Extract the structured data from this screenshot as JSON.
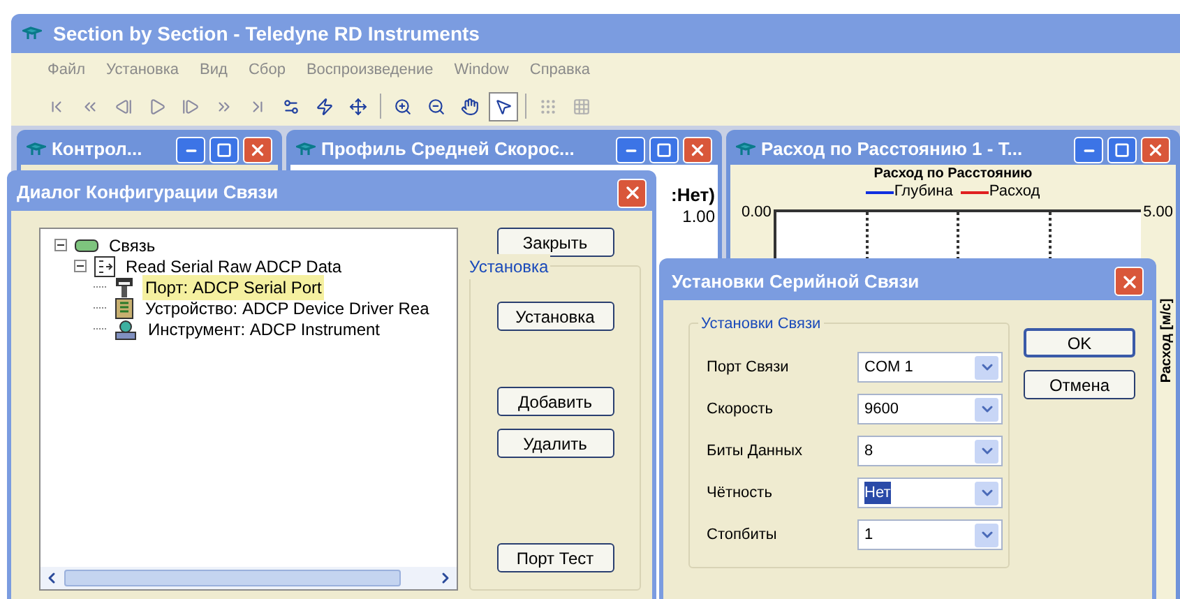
{
  "app": {
    "title": "Section by Section - Teledyne RD Instruments"
  },
  "menu": [
    "Файл",
    "Установка",
    "Вид",
    "Сбор",
    "Воспроизведение",
    "Window",
    "Справка"
  ],
  "toolbar": [
    {
      "kind": "first",
      "selected": false
    },
    {
      "kind": "fast-back",
      "selected": false
    },
    {
      "kind": "prev",
      "selected": false
    },
    {
      "kind": "play",
      "selected": false
    },
    {
      "kind": "next",
      "selected": false
    },
    {
      "kind": "pause-next",
      "selected": false
    },
    {
      "kind": "last",
      "selected": false
    },
    {
      "kind": "properties",
      "selected": false
    },
    {
      "kind": "lightning",
      "selected": false
    },
    {
      "kind": "fit",
      "selected": false
    },
    {
      "kind": "zoom-in",
      "selected": false
    },
    {
      "kind": "zoom-out",
      "selected": false
    },
    {
      "kind": "hand",
      "selected": false
    },
    {
      "kind": "pointer",
      "selected": true
    },
    {
      "kind": "grid-a",
      "selected": false
    },
    {
      "kind": "grid-b",
      "selected": false
    }
  ],
  "child_windows": [
    {
      "title": "Контрол..."
    },
    {
      "title": "Профиль Средней Скорос...",
      "texts": [
        ":Нет)",
        "1.00"
      ]
    },
    {
      "title": "Расход по Расстоянию 1 - Т...",
      "plot": {
        "title": "Расход по Расстоянию",
        "legend": [
          {
            "label": "Глубина",
            "color": "#1030e0"
          },
          {
            "label": "Расход",
            "color": "#e02020"
          }
        ],
        "left_axis": "0.00",
        "right_axis": "5.00",
        "ylabel": "Расход [м/с]"
      }
    }
  ],
  "config_dialog": {
    "title": "Диалог Конфигурации Связи",
    "tree": [
      {
        "label": "Связь",
        "kind": "link",
        "expanded": true,
        "selected": false,
        "children": [
          {
            "label": "Read Serial Raw ADCP Data",
            "kind": "module",
            "expanded": true,
            "selected": false,
            "children": [
              {
                "label": "Порт: ADCP Serial Port",
                "kind": "port",
                "selected": true
              },
              {
                "label": "Устройство: ADCP Device Driver Rea",
                "kind": "device",
                "selected": false
              },
              {
                "label": "Инструмент: ADCP Instrument",
                "kind": "instrument",
                "selected": false
              }
            ]
          }
        ]
      }
    ],
    "close_button": "Закрыть",
    "group": {
      "label": "Установка",
      "buttons": [
        "Установка",
        "Добавить",
        "Удалить"
      ]
    },
    "port_test_button": "Порт Тест"
  },
  "serial_dialog": {
    "title": "Установки Серийной Связи",
    "group_label": "Установки Связи",
    "fields": [
      {
        "label": "Порт Связи",
        "value": "COM 1",
        "text_selected": false
      },
      {
        "label": "Скорость",
        "value": "9600",
        "text_selected": false
      },
      {
        "label": "Биты Данных",
        "value": "8",
        "text_selected": false
      },
      {
        "label": "Чётность",
        "value": "Нет",
        "text_selected": true
      },
      {
        "label": "Стопбиты",
        "value": "1",
        "text_selected": false
      }
    ],
    "buttons": [
      {
        "label": "OK",
        "default": true
      },
      {
        "label": "Отмена",
        "default": false
      }
    ]
  }
}
